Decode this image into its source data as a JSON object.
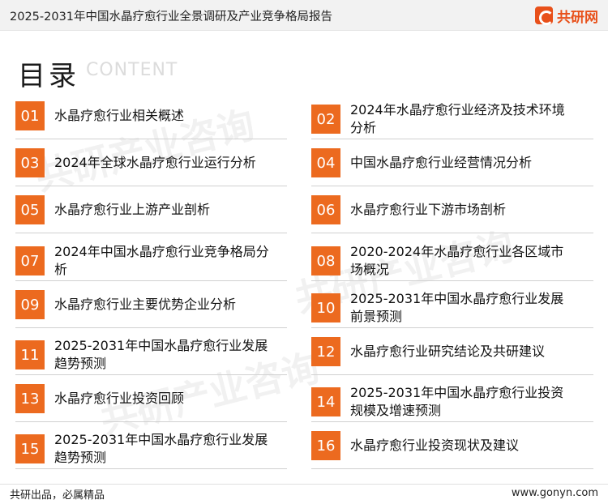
{
  "header": {
    "title": "2025-2031年中国水晶疗愈行业全景调研及产业竞争格局报告",
    "brand_name": "共研网",
    "brand_color": "#e8501a"
  },
  "toc": {
    "heading": "目录",
    "subheading": "CONTENT",
    "accent_color": "#ec6a1f",
    "items": [
      {
        "num": "01",
        "label": "水晶疗愈行业相关概述"
      },
      {
        "num": "02",
        "label": "2024年水晶疗愈行业经济及技术环境分析"
      },
      {
        "num": "03",
        "label": "2024年全球水晶疗愈行业运行分析"
      },
      {
        "num": "04",
        "label": "中国水晶疗愈行业经营情况分析"
      },
      {
        "num": "05",
        "label": "水晶疗愈行业上游产业剖析"
      },
      {
        "num": "06",
        "label": "水晶疗愈行业下游市场剖析"
      },
      {
        "num": "07",
        "label": "2024年中国水晶疗愈行业竞争格局分析"
      },
      {
        "num": "08",
        "label": "2020-2024年水晶疗愈行业各区域市场概况"
      },
      {
        "num": "09",
        "label": "水晶疗愈行业主要优势企业分析"
      },
      {
        "num": "10",
        "label": "2025-2031年中国水晶疗愈行业发展前景预测"
      },
      {
        "num": "11",
        "label": "2025-2031年中国水晶疗愈行业发展趋势预测"
      },
      {
        "num": "12",
        "label": "水晶疗愈行业研究结论及共研建议"
      },
      {
        "num": "13",
        "label": "水晶疗愈行业投资回顾"
      },
      {
        "num": "14",
        "label": "2025-2031年中国水晶疗愈行业投资规模及增速预测"
      },
      {
        "num": "15",
        "label": "2025-2031年中国水晶疗愈行业发展趋势预测"
      },
      {
        "num": "16",
        "label": "水晶疗愈行业投资现状及建议"
      }
    ]
  },
  "footer": {
    "slogan": "共研出品，必属精品",
    "website": "www.gonyn.com"
  }
}
